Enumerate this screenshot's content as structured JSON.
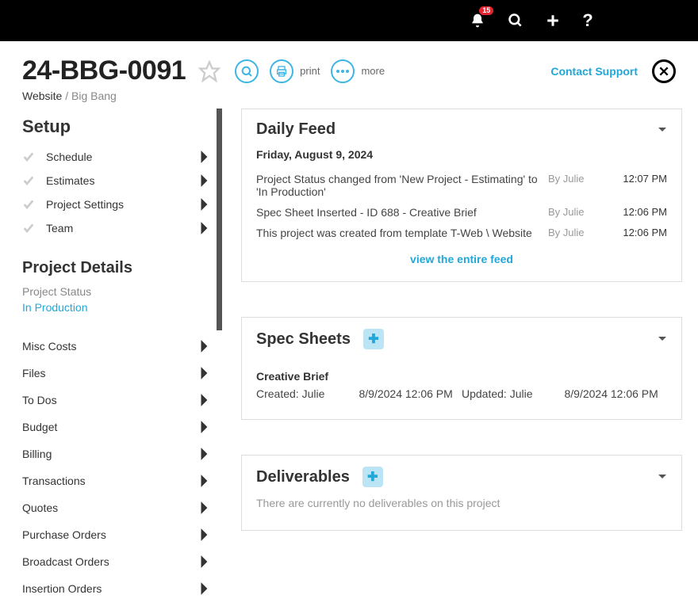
{
  "topbar": {
    "notification_count": "15"
  },
  "header": {
    "project_id": "24-BBG-0091",
    "print_label": "print",
    "more_label": "more",
    "contact_support": "Contact Support"
  },
  "breadcrumb": {
    "primary": "Website",
    "secondary": "Big Bang"
  },
  "setup": {
    "title": "Setup",
    "items": [
      {
        "label": "Schedule"
      },
      {
        "label": "Estimates"
      },
      {
        "label": "Project Settings"
      },
      {
        "label": "Team"
      }
    ]
  },
  "project_details": {
    "title": "Project Details",
    "status_label": "Project Status",
    "status_value": "In Production",
    "items": [
      {
        "label": "Misc Costs"
      },
      {
        "label": "Files"
      },
      {
        "label": "To Dos"
      },
      {
        "label": "Budget"
      },
      {
        "label": "Billing"
      },
      {
        "label": "Transactions"
      },
      {
        "label": "Quotes"
      },
      {
        "label": "Purchase Orders"
      },
      {
        "label": "Broadcast Orders"
      },
      {
        "label": "Insertion Orders"
      }
    ]
  },
  "daily_feed": {
    "title": "Daily Feed",
    "date": "Friday, August 9, 2024",
    "rows": [
      {
        "msg": "Project Status changed from 'New Project - Estimating' to 'In Production'",
        "by": "By Julie",
        "time": "12:07 PM"
      },
      {
        "msg": "Spec Sheet Inserted - ID 688 - Creative Brief",
        "by": "By Julie",
        "time": "12:06 PM"
      },
      {
        "msg": "This project was created from template T-Web \\ Website",
        "by": "By Julie",
        "time": "12:06 PM"
      }
    ],
    "view_all": "view the entire feed"
  },
  "spec_sheets": {
    "title": "Spec Sheets",
    "name": "Creative Brief",
    "created_label": "Created: Julie",
    "created_ts": "8/9/2024 12:06 PM",
    "updated_label": "Updated: Julie",
    "updated_ts": "8/9/2024 12:06 PM"
  },
  "deliverables": {
    "title": "Deliverables",
    "empty": "There are currently no deliverables on this project"
  }
}
